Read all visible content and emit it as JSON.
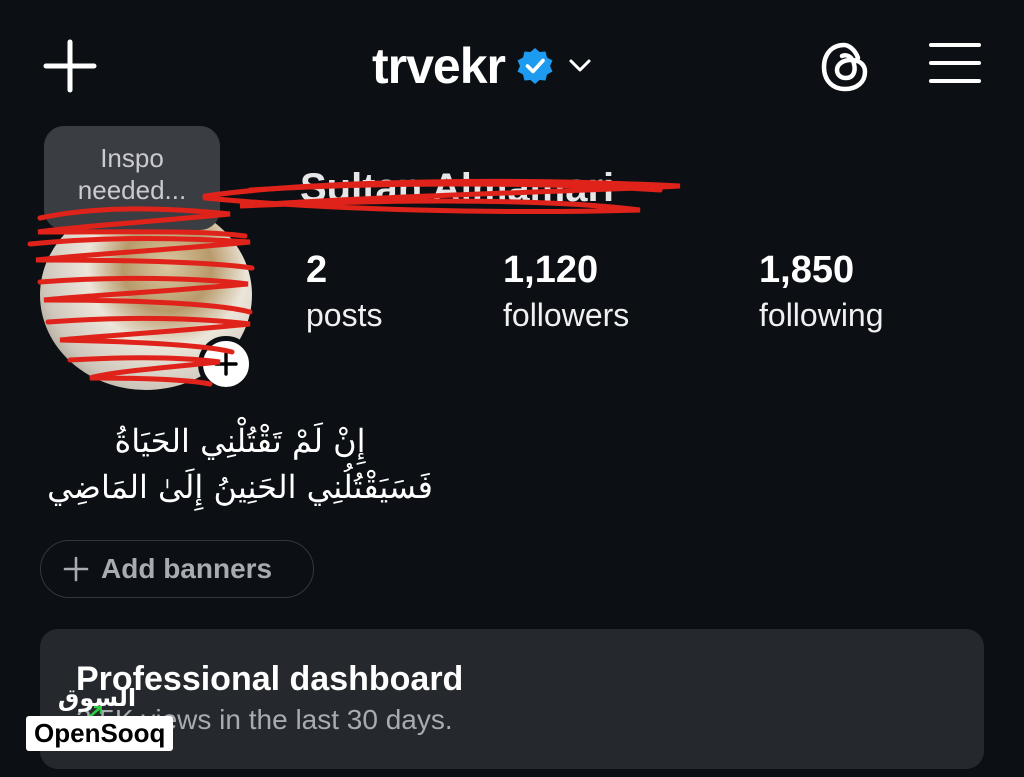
{
  "header": {
    "username": "trvekr",
    "verified": true,
    "accent_color": "#1d9bf0",
    "icons": [
      "plus-icon",
      "verified-badge-icon",
      "chevron-down-icon",
      "threads-icon",
      "hamburger-menu-icon"
    ]
  },
  "profile": {
    "note": "Inspo needed...",
    "full_name": "Sultan Almamari",
    "stats": [
      {
        "value": "2",
        "label": "posts"
      },
      {
        "value": "1,120",
        "label": "followers"
      },
      {
        "value": "1,850",
        "label": "following"
      }
    ],
    "bio_line1": "إِنْ لَمْ تَقْتُلْنِي الحَيَاةُ",
    "bio_line2": "فَسَيَقْتُلُنِي الحَنِينُ إِلَىٰ المَاضِي"
  },
  "banners": {
    "label": "Add banners"
  },
  "dashboard": {
    "title": "Professional dashboard",
    "subtitle": "2.5K views in the last 30 days."
  },
  "watermark": {
    "arabic": "السوق المفتوح",
    "brand": "OpenSooq"
  }
}
